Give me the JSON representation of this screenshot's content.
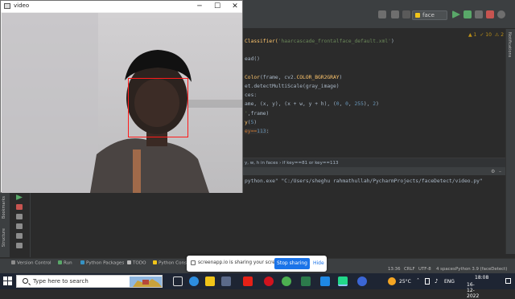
{
  "video_window": {
    "title": "video",
    "controls": {
      "minimize": "─",
      "maximize": "☐",
      "close": "✕"
    }
  },
  "ide": {
    "run_config": "face",
    "right_strip_label": "Notifications",
    "problems": {
      "warnings": "▲ 1",
      "weak": "✓ 10",
      "errors": "⚠ 2"
    },
    "editor_lines": [
      {
        "parts": [
          {
            "t": "Classifier(",
            "c": "fn"
          },
          {
            "t": "'haarcascade_frontalface_default.xml'",
            "c": "str"
          },
          {
            "t": ")",
            "c": ""
          }
        ]
      },
      {
        "parts": [
          {
            "t": "",
            "c": ""
          }
        ]
      },
      {
        "parts": [
          {
            "t": "ead()",
            "c": ""
          }
        ]
      },
      {
        "parts": [
          {
            "t": "",
            "c": ""
          }
        ]
      },
      {
        "parts": [
          {
            "t": "Color",
            "c": "fn"
          },
          {
            "t": "(frame, cv2.",
            "c": ""
          },
          {
            "t": "COLOR_BGR2GRAY",
            "c": "fn"
          },
          {
            "t": ")",
            "c": ""
          }
        ]
      },
      {
        "parts": [
          {
            "t": "et.detectMultiScale(gray_image)",
            "c": ""
          }
        ]
      },
      {
        "parts": [
          {
            "t": "ces:",
            "c": ""
          }
        ]
      },
      {
        "parts": [
          {
            "t": "ame, (x, y), (x + w, y + h), (",
            "c": ""
          },
          {
            "t": "0",
            "c": "num"
          },
          {
            "t": ", ",
            "c": ""
          },
          {
            "t": "0",
            "c": "num"
          },
          {
            "t": ", ",
            "c": ""
          },
          {
            "t": "255",
            "c": "num"
          },
          {
            "t": "), ",
            "c": ""
          },
          {
            "t": "2",
            "c": "num"
          },
          {
            "t": ")",
            "c": ""
          }
        ]
      },
      {
        "parts": [
          {
            "t": "'",
            "c": "str"
          },
          {
            "t": ",frame)",
            "c": ""
          }
        ]
      },
      {
        "parts": [
          {
            "t": "y",
            "c": "fn"
          },
          {
            "t": "(",
            "c": ""
          },
          {
            "t": "5",
            "c": "num"
          },
          {
            "t": ")",
            "c": ""
          }
        ]
      },
      {
        "parts": [
          {
            "t": "ey==",
            "c": "kw"
          },
          {
            "t": "113",
            "c": "num"
          },
          {
            "t": ":",
            "c": ""
          }
        ]
      }
    ],
    "breadcrumb": "y, w, h in faces   ›   if key==81 or key==113",
    "console_line": "python.exe\" \"C:/Users/sheghu rahmathullah/PycharmProjects/faceDetect/video.py\"",
    "left_tool_labels": {
      "bookmarks": "Bookmarks",
      "structure": "Structure"
    },
    "tool_tabs": [
      {
        "label": "Version Control",
        "color": "#8c8c8c"
      },
      {
        "label": "Run",
        "color": "#59a869"
      },
      {
        "label": "Python Packages",
        "color": "#3592c4"
      },
      {
        "label": "TODO",
        "color": "#bbbbbb"
      },
      {
        "label": "Python Console",
        "color": "#f0c419"
      }
    ],
    "status_items": [
      "13:36",
      "CRLF",
      "UTF-8",
      "4 spaces",
      "Python 3.9 (faceDetect)"
    ]
  },
  "share_bar": {
    "message": "screenapp.io is sharing your screen.",
    "stop_label": "Stop sharing",
    "hide_label": "Hide"
  },
  "taskbar": {
    "search_placeholder": "Type here to search",
    "weather": "25°C",
    "language": "ENG",
    "time": "18:08",
    "date": "16-12-2022",
    "apps": [
      "task-view",
      "edge",
      "file-explorer",
      "store",
      "youtube",
      "opera",
      "chrome",
      "unknown-app",
      "vscode",
      "pycharm",
      "screenapp"
    ]
  },
  "colors": {
    "face_box": "#ff1a1a",
    "share_button": "#1a73e8",
    "taskbar": "#1e2533",
    "ide_bg": "#2b2b2b"
  }
}
